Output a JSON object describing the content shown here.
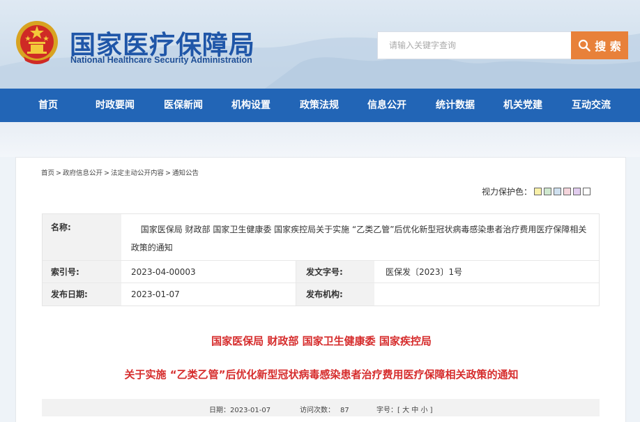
{
  "header": {
    "site_title": "国家医疗保障局",
    "site_subtitle": "National Healthcare Security Administration",
    "search_placeholder": "请输入关键字查询",
    "search_button": "搜 索"
  },
  "nav": {
    "items": [
      "首页",
      "时政要闻",
      "医保新闻",
      "机构设置",
      "政策法规",
      "信息公开",
      "统计数据",
      "机关党建",
      "互动交流"
    ]
  },
  "breadcrumb": [
    "首页",
    "政府信息公开",
    "法定主动公开内容",
    "通知公告"
  ],
  "breadcrumb_sep": ">",
  "eye_care": {
    "label": "视力保护色：",
    "swatches": [
      "#f8f0a8",
      "#cfe8cf",
      "#cfe0ef",
      "#f5d5dc",
      "#e2cdef",
      "#ffffff"
    ]
  },
  "info": {
    "name_label": "名称:",
    "name_value": "国家医保局 财政部 国家卫生健康委 国家疾控局关于实施 “乙类乙管”后优化新型冠状病毒感染患者治疗费用医疗保障相关政策的通知",
    "index_label": "索引号:",
    "index_value": "2023-04-00003",
    "doc_no_label": "发文字号:",
    "doc_no_value": "医保发〔2023〕1号",
    "date_label": "发布日期:",
    "date_value": "2023-01-07",
    "org_label": "发布机构:",
    "org_value": ""
  },
  "document": {
    "title_line1": "国家医保局 财政部 国家卫生健康委 国家疾控局",
    "title_line2": "关于实施 “乙类乙管”后优化新型冠状病毒感染患者治疗费用医疗保障相关政策的通知"
  },
  "meta": {
    "date_label": "日期：",
    "date_value": "2023-01-07",
    "visits_label": "访问次数：",
    "visits_value": "87",
    "font_label": "字号：",
    "font_open": "[",
    "font_large": "大",
    "font_medium": "中",
    "font_small": "小",
    "font_close": "]"
  }
}
